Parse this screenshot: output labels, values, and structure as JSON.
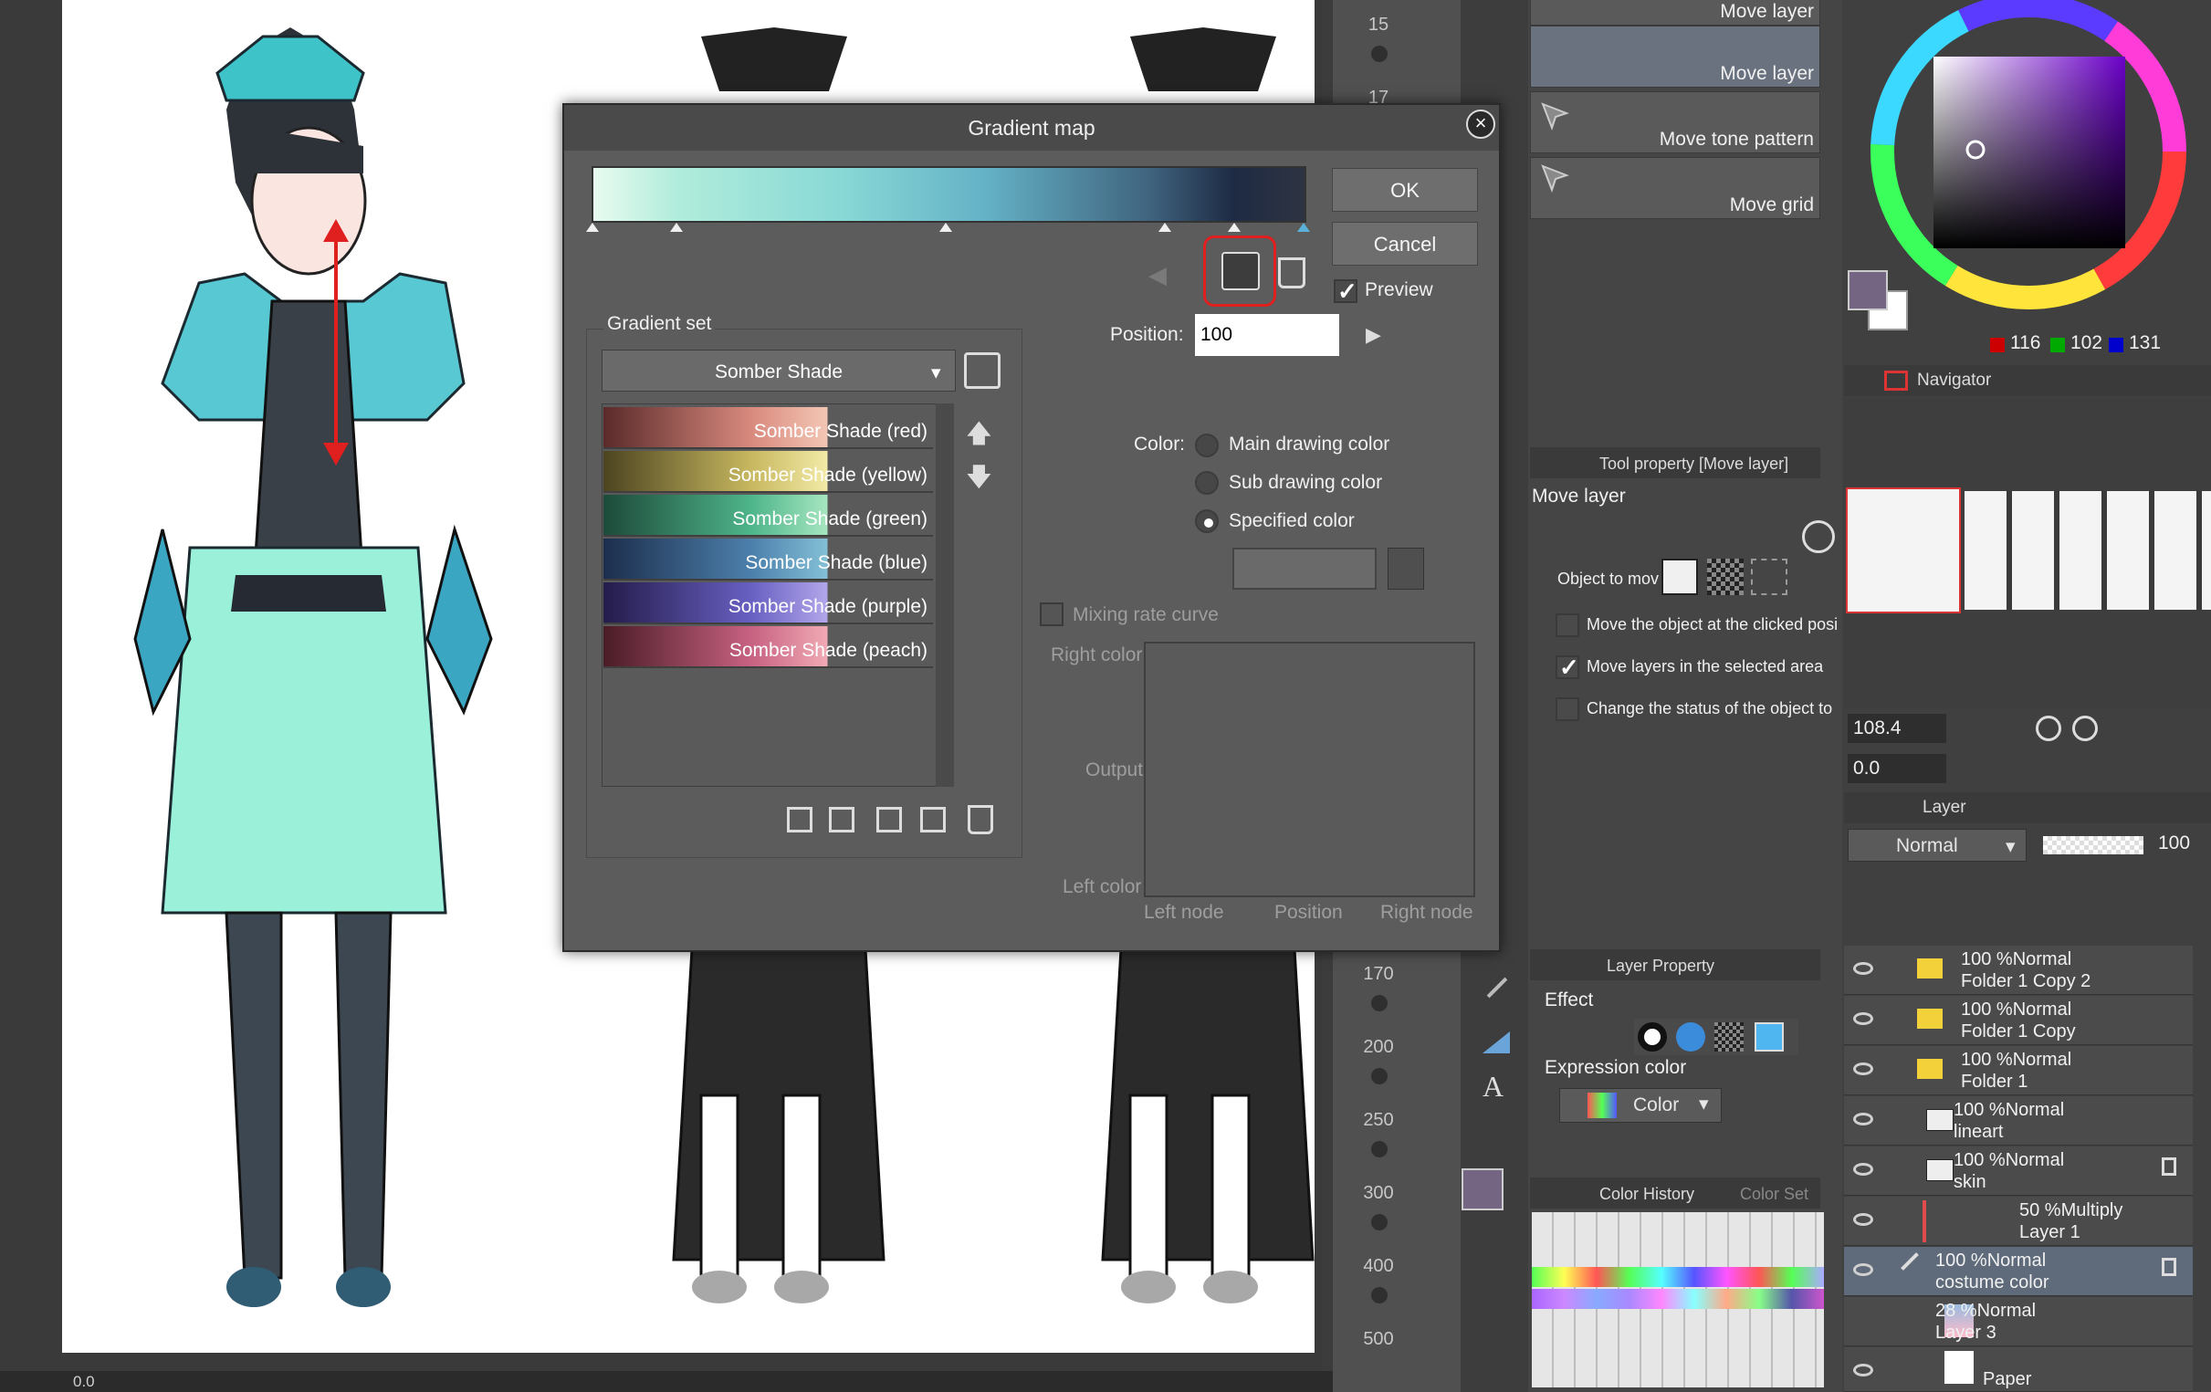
{
  "dialog": {
    "title": "Gradient map",
    "ok_label": "OK",
    "cancel_label": "Cancel",
    "preview_label": "Preview",
    "preview_checked": true,
    "position_label": "Position:",
    "position_value": "100",
    "gradient_set_label": "Gradient set",
    "gradient_set_selected": "Somber Shade",
    "gradient_sets": [
      {
        "label": "Somber Shade (red)",
        "colors": [
          "#5a2a2a",
          "#d98a7e",
          "#f3c6b4"
        ]
      },
      {
        "label": "Somber Shade (yellow)",
        "colors": [
          "#4c4420",
          "#c8b860",
          "#f2eaa6"
        ]
      },
      {
        "label": "Somber Shade (green)",
        "colors": [
          "#1d4a3a",
          "#4eb58a",
          "#a6e6c0"
        ]
      },
      {
        "label": "Somber Shade (blue)",
        "colors": [
          "#1c2e4c",
          "#4c80ac",
          "#84c0d6"
        ]
      },
      {
        "label": "Somber Shade (purple)",
        "colors": [
          "#241c4a",
          "#6860c2",
          "#b2a6ea"
        ]
      },
      {
        "label": "Somber Shade (peach)",
        "colors": [
          "#4a1c26",
          "#c86282",
          "#f0aab4"
        ]
      }
    ],
    "color_label": "Color:",
    "color_options": [
      "Main drawing color",
      "Sub drawing color",
      "Specified color"
    ],
    "color_selected": "Specified color",
    "mixing_rate_label": "Mixing rate curve",
    "right_color_label": "Right color",
    "output_label": "Output",
    "left_color_label": "Left color",
    "left_node_label": "Left node",
    "position_axis_label": "Position",
    "right_node_label": "Right node"
  },
  "sub_tool": {
    "items": [
      "Move layer",
      "Move layer",
      "Move tone pattern",
      "Move grid"
    ],
    "tool_property_title": "Tool property [Move layer]",
    "tool_property_name": "Move layer",
    "object_to_move_label": "Object to mov",
    "options": [
      {
        "label": "Move the object at the clicked posi",
        "checked": false
      },
      {
        "label": "Move layers in the selected area",
        "checked": true
      },
      {
        "label": "Change the status of the object to",
        "checked": false
      }
    ],
    "layer_property_title": "Layer Property",
    "effect_label": "Effect",
    "expression_color_label": "Expression color",
    "expression_color_value": "Color",
    "color_history_tab": "Color History",
    "color_set_tab": "Color Set"
  },
  "ruler": {
    "top_numbers": [
      "15",
      "17"
    ],
    "numbers": [
      "170",
      "200",
      "250",
      "300",
      "400",
      "500"
    ]
  },
  "color_wheel": {
    "r": "116",
    "g": "102",
    "b": "131",
    "main_color": "#746683",
    "sub_color": "#ffffff"
  },
  "navigator": {
    "title": "Navigator",
    "zoom": "108.4",
    "rotation": "0.0"
  },
  "layer_panel": {
    "title": "Layer",
    "blend_mode": "Normal",
    "opacity": "100",
    "layers": [
      {
        "top": "100 %Normal",
        "name": "Folder 1 Copy 2",
        "folder": true
      },
      {
        "top": "100 %Normal",
        "name": "Folder 1 Copy",
        "folder": true
      },
      {
        "top": "100 %Normal",
        "name": "Folder 1",
        "folder": true
      },
      {
        "top": "100 %Normal",
        "name": "lineart",
        "folder": false
      },
      {
        "top": "100 %Normal",
        "name": "skin",
        "folder": false
      },
      {
        "top": "50 %Multiply",
        "name": "Layer 1",
        "folder": false
      },
      {
        "top": "100 %Normal",
        "name": "costume color",
        "folder": false
      },
      {
        "top": "28 %Normal",
        "name": "Layer 3",
        "folder": false
      },
      {
        "top": "",
        "name": "Paper",
        "folder": false
      }
    ]
  },
  "status_bar": {
    "zoom": "0.0"
  }
}
